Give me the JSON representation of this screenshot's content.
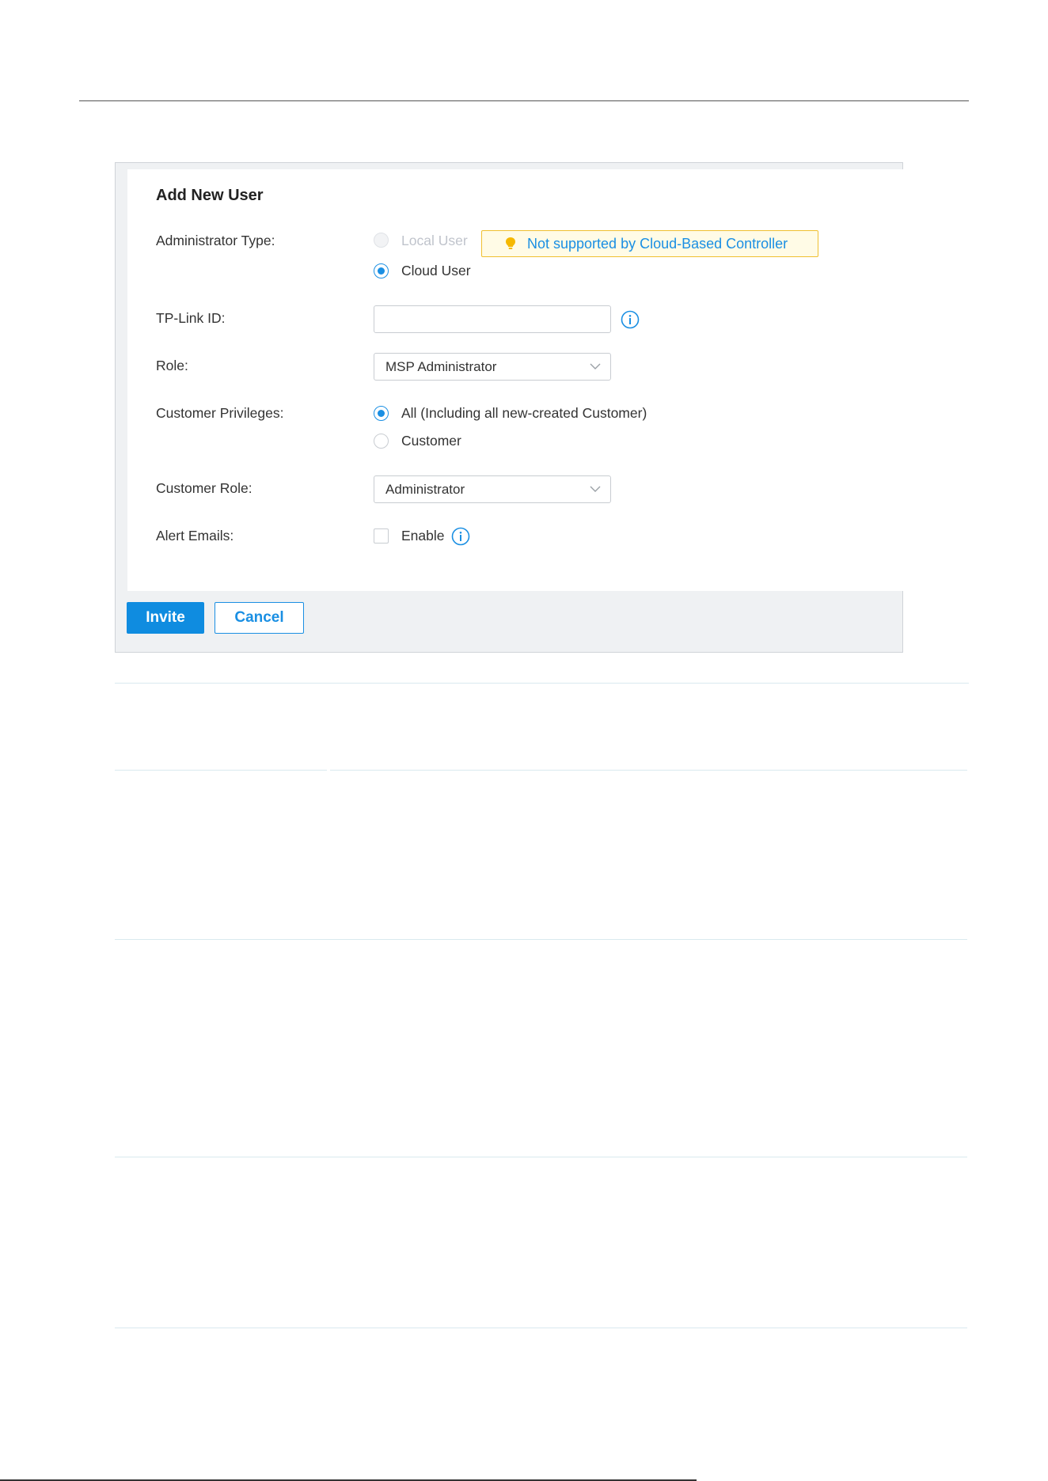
{
  "dialog": {
    "title": "Add New User",
    "fields": {
      "administrator_type": {
        "label": "Administrator Type",
        "options": [
          {
            "label": "Local User",
            "selected": false,
            "disabled": true
          },
          {
            "label": "Cloud User",
            "selected": true,
            "disabled": false
          }
        ],
        "notice": "Not supported by Cloud-Based Controller"
      },
      "tp_link_id": {
        "label": "TP-Link ID",
        "value": "",
        "placeholder": ""
      },
      "role": {
        "label": "Role",
        "value": "MSP Administrator"
      },
      "customer_privileges": {
        "label": "Customer Privileges",
        "options": [
          {
            "label": "All (Including all new-created Customer)",
            "selected": true
          },
          {
            "label": "Customer",
            "selected": false
          }
        ]
      },
      "customer_role": {
        "label": "Customer Role",
        "value": "Administrator"
      },
      "alert_emails": {
        "label": "Alert Emails",
        "checkbox_label": "Enable",
        "checked": false
      }
    },
    "buttons": {
      "invite": "Invite",
      "cancel": "Cancel"
    }
  },
  "colors": {
    "accent": "#1a8fe3",
    "primary_button": "#0f8ce0",
    "notice_border": "#f0c030",
    "notice_icon": "#f5b800"
  },
  "icons": {
    "notice": "lightbulb-icon",
    "info": "info-circle-icon",
    "dropdown": "chevron-down-icon"
  }
}
